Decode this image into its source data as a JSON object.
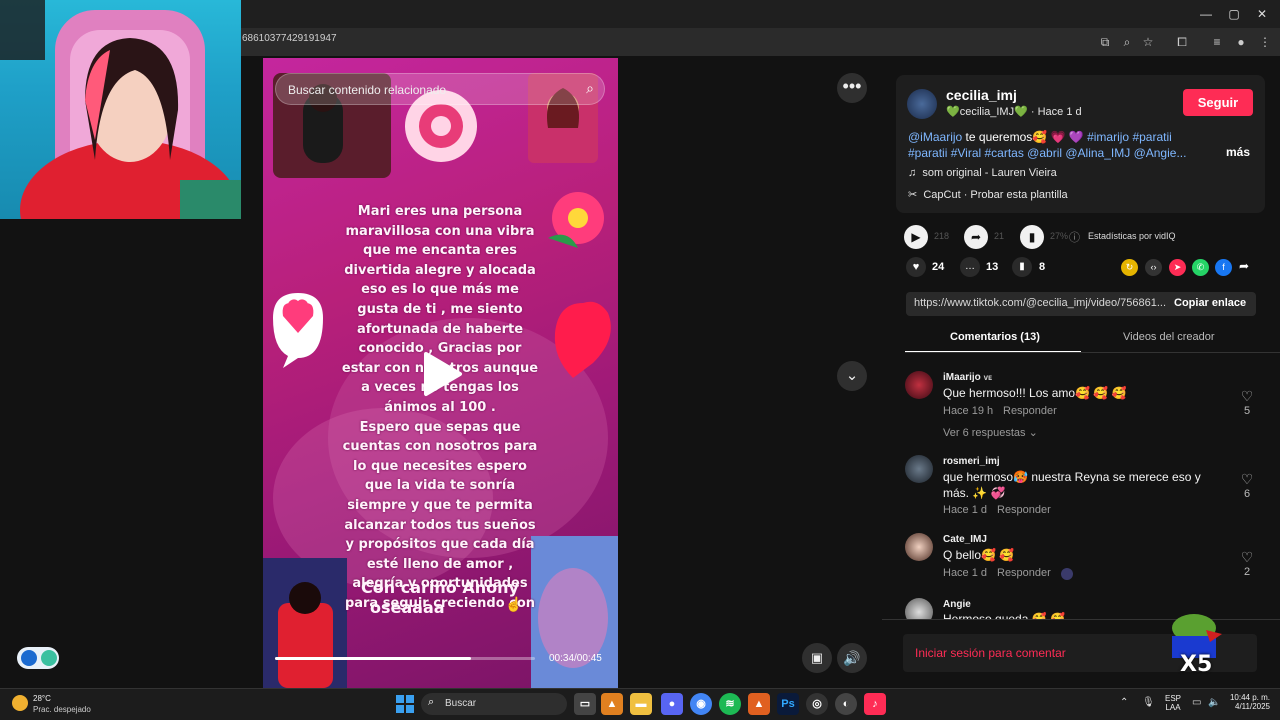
{
  "browser": {
    "url": "68610377429191947"
  },
  "video": {
    "search_placeholder": "Buscar contenido relacionado",
    "lines": [
      "Mari eres una persona",
      "maravillosa con una vibra",
      "que me encanta eres",
      "divertida alegre y alocada",
      "eso es lo que más me",
      "gusta de ti , me siento",
      "afortunada de haberte",
      "conocido , Gracias por",
      "estar con nosotros aunque",
      "a veces no tengas los",
      "ánimos al 100 .",
      "Espero que sepas que",
      "cuentas con nosotros para",
      "lo que necesites espero",
      "que la vida te sonría",
      "siempre y que te permita",
      "alcanzar todos tus sueños",
      "y propósitos que cada día",
      "esté lleno de amor ,",
      "alegría y oportunidades",
      "para seguir creciendo con"
    ],
    "signature_line1": "Con cariño Anony",
    "signature_line2": "oseaaaa",
    "time": "00:34/00:45",
    "progress_fraction": 0.755
  },
  "post": {
    "author": "cecilia_imj",
    "nickname": "💚cecilia_IMJ💚",
    "sep": "·",
    "posted": "Hace 1 d",
    "follow_label": "Seguir",
    "caption_line1_mention": "@iMaarijo",
    "caption_line1_rest": "te queremos🥰 💗 💜",
    "caption_line1_tags": "#imarijo #paratii",
    "caption_line2": "#paratii #Viral #cartas @abril @Alina_IMJ @Angie...",
    "more_label": "más",
    "sound": "som original - Lauren Vieira",
    "capcut": "CapCut · Probar esta plantilla"
  },
  "stats": {
    "plays": "218",
    "shares": "21",
    "percent": "27%",
    "stats_label": "Estadísticas por vidIQ",
    "likes": "24",
    "comments": "13",
    "saves": "8"
  },
  "link": {
    "url": "https://www.tiktok.com/@cecilia_imj/video/756861...",
    "copy_label": "Copiar enlace"
  },
  "tabs": {
    "comments": "Comentarios (13)",
    "creator_videos": "Videos del creador"
  },
  "comments": [
    {
      "name": "iMaarijo",
      "badge": "ᴠᴇ",
      "text": "Que hermoso!!! Los amo🥰 🥰 🥰",
      "time": "Hace 19 h",
      "reply": "Responder",
      "likes": "5",
      "view_replies": "Ver 6 respuestas"
    },
    {
      "name": "rosmeri_imj",
      "text1": "que hermoso🥵 nuestra Reyna se merece eso y",
      "text2": "más. ✨ 💞",
      "time": "Hace 1 d",
      "reply": "Responder",
      "likes": "6"
    },
    {
      "name": "Cate_IMJ",
      "text": "Q bello🥰 🥰",
      "time": "Hace 1 d",
      "reply": "Responder",
      "likes": "2"
    },
    {
      "name": "Angie",
      "text": "Hermoso queda 🥰 🥰"
    }
  ],
  "login_prompt": "Iniciar sesión para comentar",
  "sticker_text": "X5",
  "taskbar": {
    "temp": "28°C",
    "weather": "Prac. despejado",
    "search": "Buscar",
    "lang1": "ESP",
    "lang2": "LAA",
    "time": "10:44 p. m.",
    "date": "4/11/2025",
    "ps_label": "Ps"
  },
  "colors": {
    "accent": "#fe2c55",
    "link": "#7fb7ff"
  }
}
